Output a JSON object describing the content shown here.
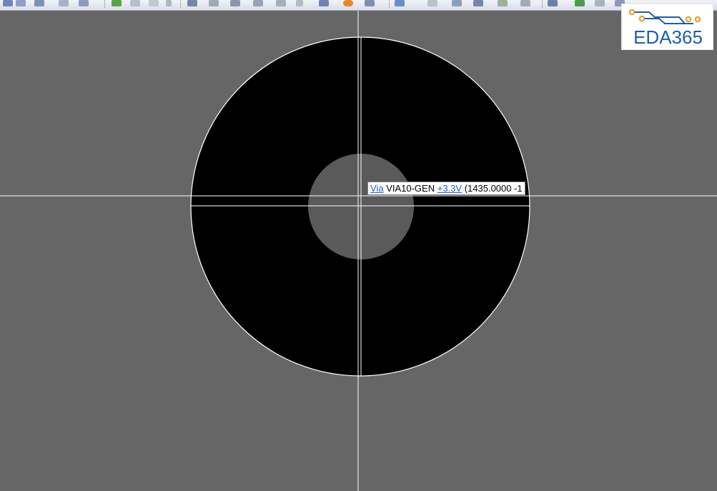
{
  "toolbar": {
    "groups": [
      {
        "icons": [
          "save-icon",
          "save-all-icon",
          "export-icon",
          "print-icon"
        ]
      },
      {
        "icons": [
          "layer-icon",
          "wire-icon",
          "arrow-icon"
        ]
      },
      {
        "icons": [
          "route-icon",
          "select-icon",
          "edit-icon",
          "move-icon",
          "rotate-icon",
          "grid-icon",
          "bug-icon",
          "array-icon"
        ]
      },
      {
        "icons": [
          "measure-icon",
          "doc-icon",
          "cube-icon",
          "chip-icon",
          "drc-icon",
          "link-icon"
        ]
      },
      {
        "icons": [
          "layers-icon",
          "report-icon",
          "board-icon",
          "db-icon"
        ]
      }
    ]
  },
  "canvas": {
    "background": "#666666",
    "pad_color": "#000000",
    "drill_color": "#5a5a5a",
    "crosshair_color": "#ffffff",
    "outline_color": "#ffffff"
  },
  "tooltip": {
    "type_link": "Via",
    "padstack": "VIA10-GEN",
    "net_link": "+3.3V",
    "coords": "(1435.0000 -1"
  },
  "logo": {
    "text": "EDA365",
    "text_color": "#1b5fae",
    "accent_color": "#e0a020"
  }
}
